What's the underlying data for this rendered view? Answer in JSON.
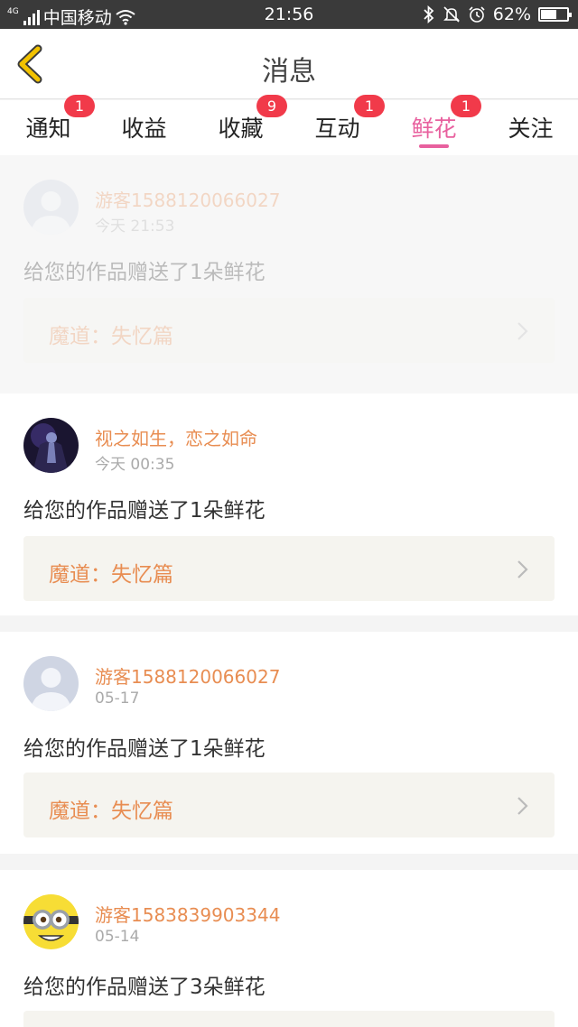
{
  "status_bar": {
    "network_tag": "4G",
    "carrier": "中国移动",
    "time": "21:56",
    "battery_percent": "62%",
    "battery_level": 0.62,
    "icons": [
      "signal-icon",
      "wifi-icon",
      "bluetooth-icon",
      "mute-icon",
      "alarm-icon",
      "battery-icon"
    ]
  },
  "header": {
    "title": "消息",
    "back_icon": "chevron-left-icon"
  },
  "tabs": [
    {
      "label": "通知",
      "badge": "1"
    },
    {
      "label": "收益",
      "badge": ""
    },
    {
      "label": "收藏",
      "badge": "9"
    },
    {
      "label": "互动",
      "badge": "1"
    },
    {
      "label": "鲜花",
      "badge": "1",
      "active": true
    },
    {
      "label": "关注",
      "badge": ""
    }
  ],
  "messages": [
    {
      "username": "游客1588120066027",
      "time": "今天 21:53",
      "text": "给您的作品赠送了1朵鲜花",
      "work_title": "魔道：失忆篇",
      "avatar": "default-avatar",
      "faded": true
    },
    {
      "username": "视之如生，恋之如命",
      "time": "今天 00:35",
      "text": "给您的作品赠送了1朵鲜花",
      "work_title": "魔道：失忆篇",
      "avatar": "dark-photo-avatar"
    },
    {
      "username": "游客1588120066027",
      "time": "05-17",
      "text": "给您的作品赠送了1朵鲜花",
      "work_title": "魔道：失忆篇",
      "avatar": "default-avatar"
    },
    {
      "username": "游客1583839903344",
      "time": "05-14",
      "text": "给您的作品赠送了3朵鲜花",
      "work_title": "",
      "avatar": "minion-avatar"
    }
  ],
  "colors": {
    "accent_pink": "#e8609e",
    "badge_red": "#f13a4a",
    "username_orange": "#e88d52",
    "back_arrow_yellow": "#f2c200"
  }
}
